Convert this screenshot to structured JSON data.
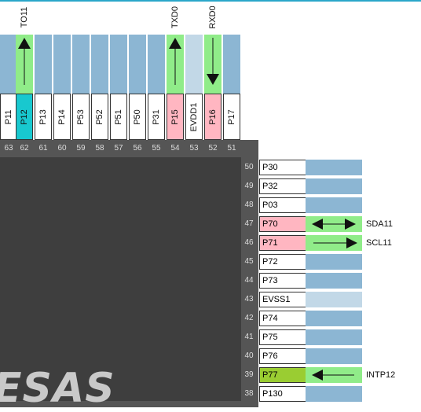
{
  "top_pins": [
    {
      "name": "",
      "num": "",
      "style": "blue",
      "partial": true
    },
    {
      "name": "P11",
      "num": "63",
      "style": "blue"
    },
    {
      "name": "P12",
      "num": "62",
      "style": "cyan"
    },
    {
      "name": "P13",
      "num": "61",
      "style": "blue"
    },
    {
      "name": "P14",
      "num": "60",
      "style": "blue"
    },
    {
      "name": "P53",
      "num": "59",
      "style": "blue"
    },
    {
      "name": "P52",
      "num": "58",
      "style": "blue"
    },
    {
      "name": "P51",
      "num": "57",
      "style": "blue"
    },
    {
      "name": "P50",
      "num": "56",
      "style": "blue"
    },
    {
      "name": "P31",
      "num": "55",
      "style": "blue"
    },
    {
      "name": "P15",
      "num": "54",
      "style": "pink"
    },
    {
      "name": "EVDD1",
      "num": "53",
      "style": "light"
    },
    {
      "name": "P16",
      "num": "52",
      "style": "pink"
    },
    {
      "name": "P17",
      "num": "51",
      "style": "blue"
    }
  ],
  "top_signals": {
    "p12": "TO11",
    "p15": "TXD0",
    "p16": "RXD0"
  },
  "right_pins": [
    {
      "num": "50",
      "name": "P30",
      "style": "",
      "stub": "blue"
    },
    {
      "num": "49",
      "name": "P32",
      "style": "",
      "stub": "blue"
    },
    {
      "num": "48",
      "name": "P03",
      "style": "",
      "stub": "blue"
    },
    {
      "num": "47",
      "name": "P70",
      "style": "pink",
      "stub": "green",
      "signal": "SDA11",
      "dir": "both"
    },
    {
      "num": "46",
      "name": "P71",
      "style": "pink",
      "stub": "green",
      "signal": "SCL11",
      "dir": "out"
    },
    {
      "num": "45",
      "name": "P72",
      "style": "",
      "stub": "blue"
    },
    {
      "num": "44",
      "name": "P73",
      "style": "",
      "stub": "blue"
    },
    {
      "num": "43",
      "name": "EVSS1",
      "style": "",
      "stub": "light"
    },
    {
      "num": "42",
      "name": "P74",
      "style": "",
      "stub": "blue"
    },
    {
      "num": "41",
      "name": "P75",
      "style": "",
      "stub": "blue"
    },
    {
      "num": "40",
      "name": "P76",
      "style": "",
      "stub": "blue"
    },
    {
      "num": "39",
      "name": "P77",
      "style": "lime",
      "stub": "green",
      "signal": "INTP12",
      "dir": "in"
    },
    {
      "num": "38",
      "name": "P130",
      "style": "",
      "stub": "blue"
    }
  ],
  "chip": {
    "logo_text": "ESAS"
  },
  "colors": {
    "stub_blue": "#8cb6d3",
    "stub_light": "#c2d8e7",
    "stub_green": "#90ec89",
    "pink": "#ffb6c1",
    "cyan": "#18c8cf",
    "lime": "#9acd32"
  }
}
